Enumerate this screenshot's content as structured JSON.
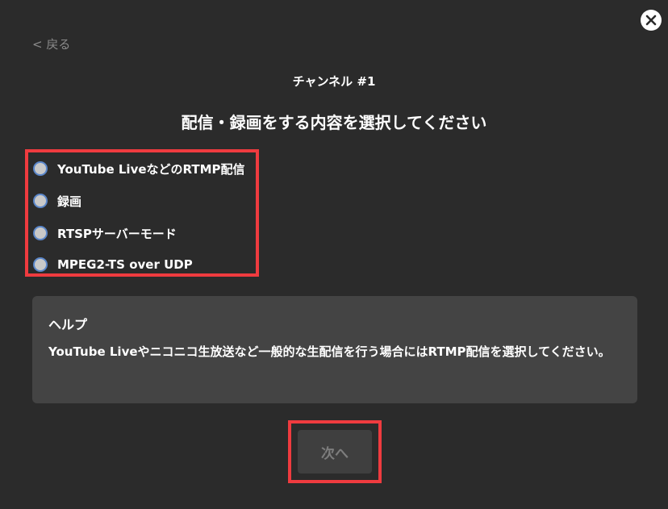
{
  "header": {
    "back_label": "< 戻る",
    "channel_title": "チャンネル #1",
    "heading": "配信・録画をする内容を選択してください"
  },
  "options": [
    {
      "label": "YouTube LiveなどのRTMP配信",
      "selected": false
    },
    {
      "label": "録画",
      "selected": false
    },
    {
      "label": "RTSPサーバーモード",
      "selected": false
    },
    {
      "label": "MPEG2-TS over UDP",
      "selected": false
    }
  ],
  "help": {
    "title": "ヘルプ",
    "text": "YouTube Liveやニコニコ生放送など一般的な生配信を行う場合にはRTMP配信を選択してください。"
  },
  "footer": {
    "next_label": "次へ"
  },
  "colors": {
    "background": "#2b2b2b",
    "highlight": "#ef3b3f",
    "radio_border": "#5a86c9",
    "help_background": "#444444"
  },
  "icons": {
    "close": "close-icon"
  }
}
